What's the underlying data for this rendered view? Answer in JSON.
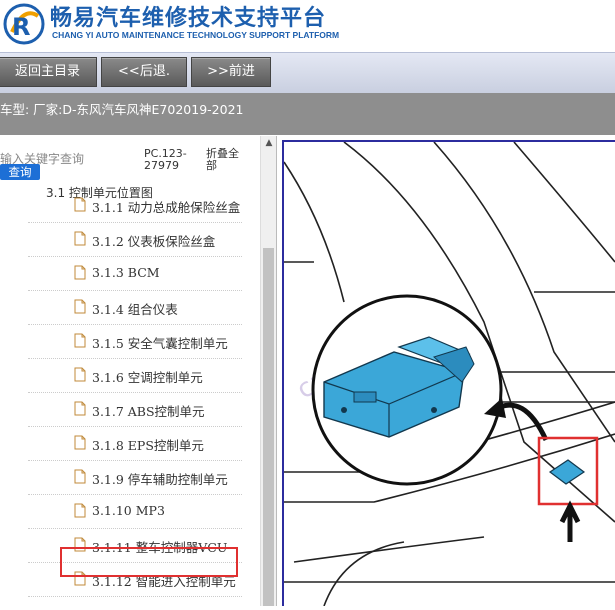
{
  "header": {
    "title_cn": "畅易汽车维修技术支持平台",
    "title_en": "CHANG YI AUTO MAINTENANCE TECHNOLOGY SUPPORT PLATFORM",
    "logo_icon": "cy-logo-icon",
    "brand_color": "#1d5fae"
  },
  "nav": {
    "home": "返回主目录",
    "back": "<<后退.",
    "forward": ">>前进"
  },
  "car": {
    "label": "车型:  厂家:D-东风汽车风神E702019-2021"
  },
  "search": {
    "placeholder": "输入关键字查询",
    "button": "查询",
    "pc": "PC.123-27979",
    "fold": "折叠全部"
  },
  "tree": {
    "partial": "3.1 控制单元位置图",
    "items": [
      {
        "label": "3.1.1 动力总成舱保险丝盒"
      },
      {
        "label": "3.1.2 仪表板保险丝盒"
      },
      {
        "label": "3.1.3 BCM"
      },
      {
        "label": "3.1.4 组合仪表"
      },
      {
        "label": "3.1.5 安全气囊控制单元"
      },
      {
        "label": "3.1.6 空调控制单元"
      },
      {
        "label": "3.1.7 ABS控制单元"
      },
      {
        "label": "3.1.8 EPS控制单元"
      },
      {
        "label": "3.1.9 停车辅助控制单元"
      },
      {
        "label": "3.1.10 MP3"
      },
      {
        "label": "3.1.11 整车控制器VCU"
      },
      {
        "label": "3.1.12 智能进入控制单元"
      }
    ],
    "selected_index": 10,
    "highlight_color": "#e03030"
  },
  "diagram": {
    "watermark": "car388.com",
    "component_color": "#3ba7d8",
    "marker_color": "#e03030"
  }
}
